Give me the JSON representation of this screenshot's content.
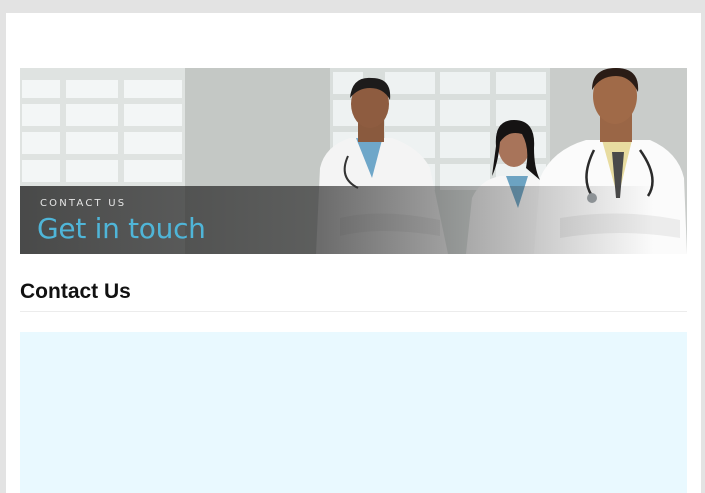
{
  "banner": {
    "kicker": "CONTACT US",
    "headline": "Get in touch",
    "image": "doctors-team-photo",
    "colors": {
      "headline": "#4fb5d8",
      "kicker": "#e6e6e6",
      "overlay": "#333333"
    }
  },
  "main": {
    "title": "Contact Us",
    "content_background": "#e9f9ff"
  },
  "colors": {
    "page_background": "#e3e3e3",
    "card_background": "#ffffff",
    "title": "#111111"
  }
}
